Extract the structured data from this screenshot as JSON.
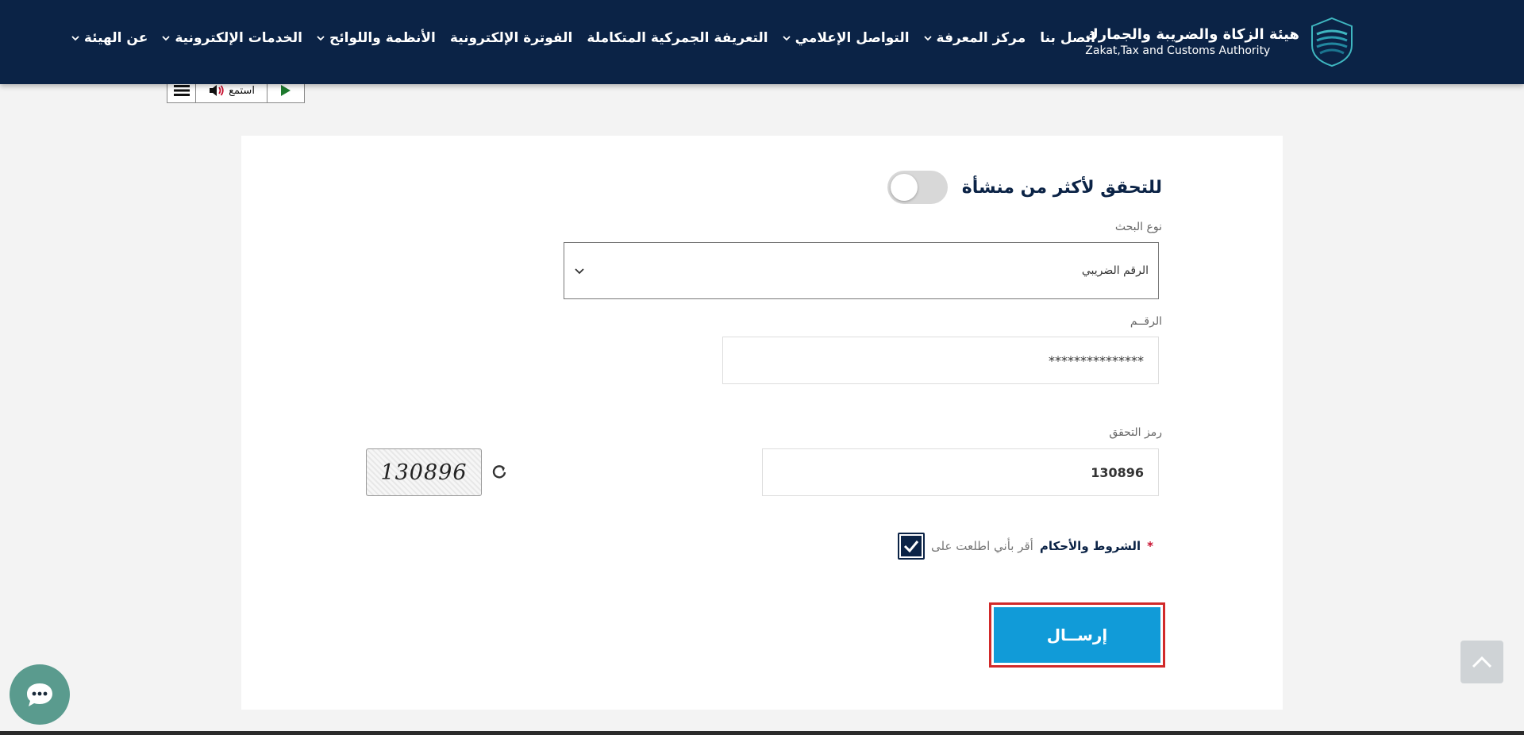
{
  "header": {
    "logo_ar": "هيئة الزكاة والضريبة والجمارك",
    "logo_en": "Zakat,Tax and Customs Authority",
    "nav": [
      {
        "label": "عن الهيئة",
        "dropdown": true
      },
      {
        "label": "الخدمات الإلكترونية",
        "dropdown": true
      },
      {
        "label": "الأنظمة واللوائح",
        "dropdown": true
      },
      {
        "label": "الفوترة الإلكترونية",
        "dropdown": false
      },
      {
        "label": "التعريفة الجمركية المتكاملة",
        "dropdown": false
      },
      {
        "label": "التواصل الإعلامي",
        "dropdown": true
      },
      {
        "label": "مركز المعرفة",
        "dropdown": true
      },
      {
        "label": "اتصل بنا",
        "dropdown": false
      }
    ]
  },
  "a11y": {
    "listen_label": "استمع"
  },
  "form": {
    "toggle_label": "للتحقق لأكثر من منشأة",
    "toggle_on": false,
    "search_type_label": "نوع البحث",
    "search_type_value": "الرقم الضريبي",
    "number_label": "الرقــم",
    "number_value": "***************",
    "captcha_label": "رمز التحقق",
    "captcha_value": "130896",
    "captcha_image_text": "130896",
    "terms_prefix": "أقر بأني اطلعت على",
    "terms_link": "الشروط والأحكام",
    "terms_required": "*",
    "terms_checked": true,
    "submit_label": "إرســال"
  },
  "colors": {
    "header_bg": "#0b2346",
    "submit_bg": "#119bd8",
    "highlight": "#d12a2a",
    "chat_bg": "#5a9b8e"
  }
}
